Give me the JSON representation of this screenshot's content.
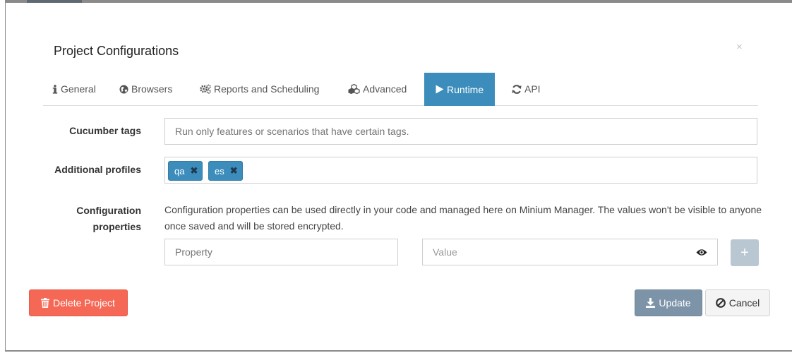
{
  "modal": {
    "title": "Project Configurations",
    "close": "×"
  },
  "tabs": [
    {
      "label": "General",
      "icon": "info-icon",
      "active": false
    },
    {
      "label": "Browsers",
      "icon": "globe-icon",
      "active": false
    },
    {
      "label": "Reports and Scheduling",
      "icon": "gears-icon",
      "active": false
    },
    {
      "label": "Advanced",
      "icon": "cubes-icon",
      "active": false
    },
    {
      "label": "Runtime",
      "icon": "play-icon",
      "active": true
    },
    {
      "label": "API",
      "icon": "refresh-icon",
      "active": false
    }
  ],
  "form": {
    "cucumber_tags": {
      "label": "Cucumber tags",
      "placeholder": "Run only features or scenarios that have certain tags.",
      "value": ""
    },
    "additional_profiles": {
      "label": "Additional profiles",
      "tags": [
        "qa",
        "es"
      ],
      "remove_symbol": "✖"
    },
    "configuration_properties": {
      "label_line1": "Configuration",
      "label_line2": "properties",
      "help_text": "Configuration properties can be used directly in your code and managed here on Minium Manager. The values won't be visible to anyone once saved and will be stored encrypted.",
      "property_placeholder": "Property",
      "value_placeholder": "Value",
      "add_symbol": "+"
    }
  },
  "footer": {
    "delete_label": "Delete Project",
    "update_label": "Update",
    "cancel_label": "Cancel"
  },
  "colors": {
    "primary": "#3c8dbc",
    "danger": "#f66856",
    "update": "#7c93a8",
    "add_button": "#b9c7d3"
  }
}
